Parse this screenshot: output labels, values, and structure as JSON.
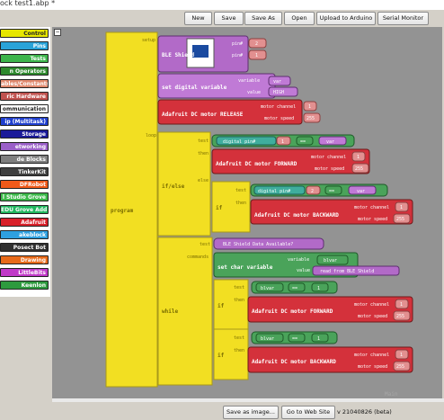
{
  "window": {
    "title": "ock test1.abp *"
  },
  "toolbar": {
    "new": "New",
    "save": "Save",
    "save_as": "Save As",
    "open": "Open",
    "upload": "Upload to Arduino",
    "serial": "Serial Monitor"
  },
  "palette": {
    "items": [
      {
        "label": "Control",
        "color": "#e6e600"
      },
      {
        "label": "Pins",
        "color": "#2aa3d8"
      },
      {
        "label": "Tests",
        "color": "#3cb44b"
      },
      {
        "label": "n Operators",
        "color": "#2f8a2f"
      },
      {
        "label": "ables/Constants",
        "color": "#e0896e"
      },
      {
        "label": "ric Hardware",
        "color": "#c0524f"
      },
      {
        "label": "ommunication",
        "color": "#ffffff"
      },
      {
        "label": "ip (Multitask)",
        "color": "#1f3fcf"
      },
      {
        "label": "Storage",
        "color": "#1a1a99"
      },
      {
        "label": "etworking",
        "color": "#9a5fc8"
      },
      {
        "label": "de Blocks",
        "color": "#7f7f7f"
      },
      {
        "label": "TinkerKit",
        "color": "#3f3f3f"
      },
      {
        "label": "DFRobot",
        "color": "#f05a1a"
      },
      {
        "label": "l Studio Grove",
        "color": "#3cb84a"
      },
      {
        "label": "EDU Grove Add",
        "color": "#1fb75e"
      },
      {
        "label": "Adafruit",
        "color": "#d8202a"
      },
      {
        "label": "akeblock",
        "color": "#2ea0e0"
      },
      {
        "label": "Posect Bot",
        "color": "#2f2f2f"
      },
      {
        "label": "Drawing",
        "color": "#e86a1a"
      },
      {
        "label": "LittleBits",
        "color": "#c038c8"
      },
      {
        "label": "Keenlon",
        "color": "#2e9a3e"
      }
    ]
  },
  "program": {
    "label": "program",
    "setup_label": "setup",
    "loop_label": "loop",
    "ble_shield": {
      "label": "BLE Shield",
      "pin_label": "pin#",
      "pin_a": "2",
      "pin_b": "1"
    },
    "set_digital": {
      "label": "set digital variable",
      "var_label": "variable",
      "var": "var",
      "value_label": "value",
      "value": "HIGH"
    },
    "release": {
      "label": "Adafruit DC motor RELEASE",
      "ch_label": "motor channel",
      "ch": "1",
      "spd_label": "motor speed",
      "spd": "255"
    },
    "ifelse1": {
      "label": "if/else",
      "test_label": "test",
      "then_label": "then",
      "else_label": "else",
      "cond_pin_label": "digital pin#",
      "cond_pin": "1",
      "cond_op": "==",
      "cond_var": "var",
      "forward": {
        "label": "Adafruit DC motor FORWARD",
        "ch_label": "motor channel",
        "ch": "1",
        "spd_label": "motor speed",
        "spd": "255"
      }
    },
    "if_inner": {
      "label": "if",
      "test_label": "test",
      "then_label": "then",
      "cond_pin_label": "digital pin#",
      "cond_pin": "2",
      "cond_op": "==",
      "cond_var": "var",
      "backward": {
        "label": "Adafruit DC motor BACKWARD",
        "ch_label": "motor channel",
        "ch": "1",
        "spd_label": "motor speed",
        "spd": "255"
      }
    },
    "while": {
      "label": "while",
      "test_label": "test",
      "cmd_label": "commands",
      "cond": "BLE Shield Data Available?",
      "set_char": {
        "label": "set char variable",
        "var_label": "variable",
        "var": "blvar",
        "value_label": "value",
        "value": "read from BLE Shield"
      },
      "if1": {
        "label": "if",
        "test_label": "test",
        "then_label": "then",
        "var": "blvar",
        "op": "==",
        "val": "1",
        "forward": {
          "label": "Adafruit DC motor FORWARD",
          "ch_label": "motor channel",
          "ch": "1",
          "spd_label": "motor speed",
          "spd": "255"
        }
      },
      "if2": {
        "label": "if",
        "test_label": "test",
        "then_label": "then",
        "var": "blvar",
        "op": "==",
        "val": "1",
        "backward": {
          "label": "Adafruit DC motor BACKWARD",
          "ch_label": "motor channel",
          "ch": "1",
          "spd_label": "motor speed",
          "spd": "255"
        }
      }
    }
  },
  "workspace": {
    "watermark": "Main"
  },
  "bottom": {
    "save_image": "Save as image...",
    "website": "Go to Web Site",
    "version": "v 21040826 (beta)"
  }
}
